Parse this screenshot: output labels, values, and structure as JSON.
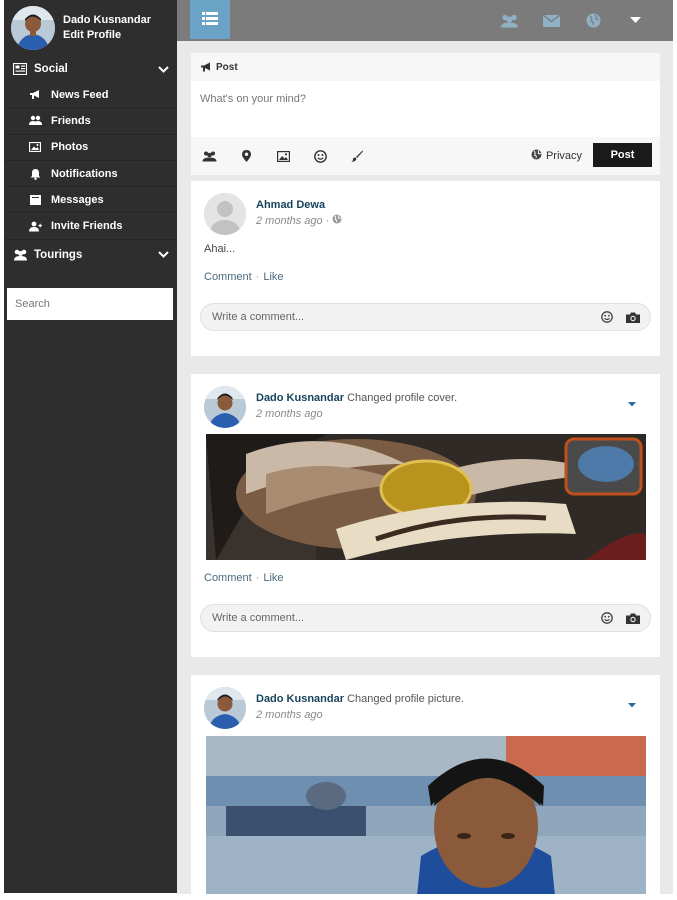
{
  "sidebar": {
    "user_name": "Dado Kusnandar",
    "edit_profile": "Edit Profile",
    "groups": [
      {
        "label": "Social",
        "icon": "newspaper-icon",
        "items": [
          {
            "label": "News Feed",
            "icon": "bullhorn-icon"
          },
          {
            "label": "Friends",
            "icon": "users-icon"
          },
          {
            "label": "Photos",
            "icon": "image-icon"
          },
          {
            "label": "Notifications",
            "icon": "bell-icon"
          },
          {
            "label": "Messages",
            "icon": "inbox-icon"
          },
          {
            "label": "Invite Friends",
            "icon": "user-plus-icon"
          }
        ]
      },
      {
        "label": "Tourings",
        "icon": "users-icon",
        "items": []
      }
    ],
    "search_placeholder": "Search"
  },
  "topbar": {
    "accent": "#6aa3c5",
    "icons": [
      "users-icon",
      "envelope-icon",
      "globe-icon",
      "caret-down-icon"
    ]
  },
  "composer": {
    "header": "Post",
    "placeholder": "What's on your mind?",
    "tools": [
      "users-icon",
      "map-marker-icon",
      "image-icon",
      "smiley-icon",
      "brush-icon"
    ],
    "privacy": "Privacy",
    "post_button": "Post"
  },
  "posts": [
    {
      "author": "Ahmad Dewa",
      "action": "",
      "time": "2 months ago ·",
      "text": "Ahai...",
      "comment": "Comment",
      "like": "Like",
      "comment_placeholder": "Write a comment..."
    },
    {
      "author": "Dado Kusnandar",
      "action": "Changed profile cover.",
      "time": "2 months ago",
      "image": "Harley Owners Group patch",
      "comment": "Comment",
      "like": "Like",
      "comment_placeholder": "Write a comment..."
    },
    {
      "author": "Dado Kusnandar",
      "action": "Changed profile picture.",
      "time": "2 months ago",
      "image": "Profile photo of a man in a stadium"
    }
  ],
  "colors": {
    "sidebar_bg": "#2e2e2e",
    "topbar_bg": "#7b7b7b",
    "content_bg": "#e9e9e9",
    "author": "#17445c"
  }
}
